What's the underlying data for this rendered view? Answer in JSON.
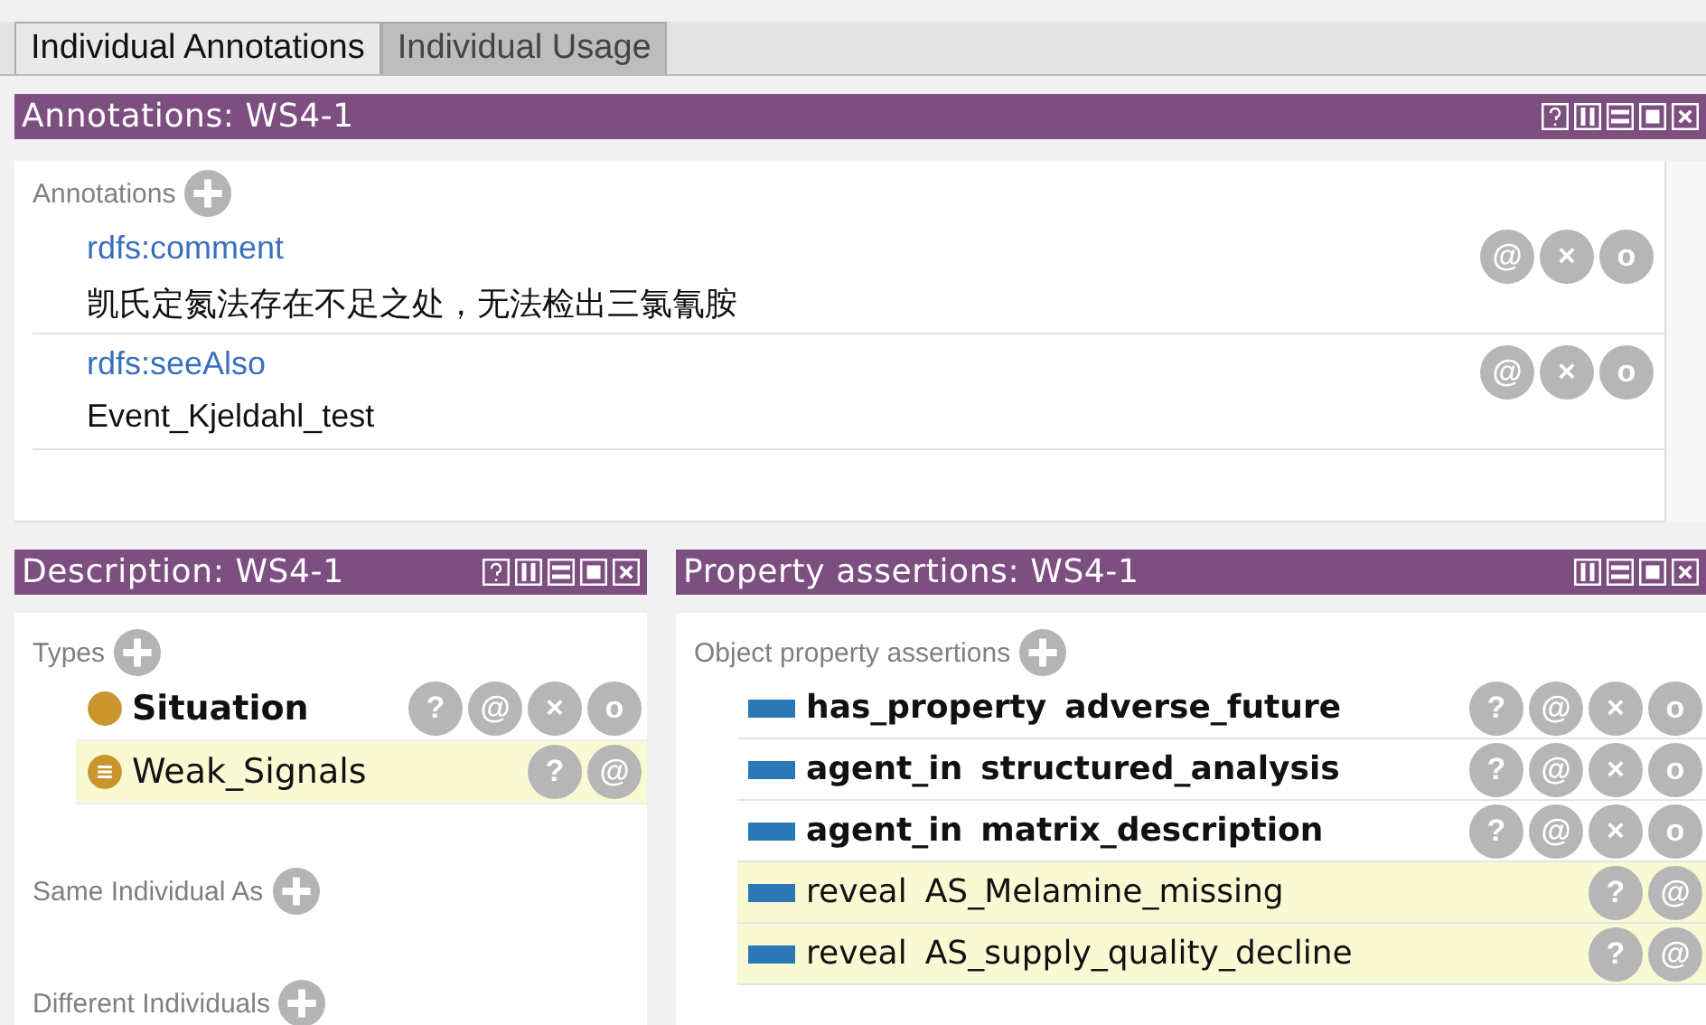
{
  "tabs": [
    {
      "label": "Individual Annotations",
      "selected": true
    },
    {
      "label": "Individual Usage",
      "selected": false
    }
  ],
  "annotations": {
    "title": "Annotations: WS4-1",
    "help": true,
    "section": "Annotations",
    "items": [
      {
        "property": "rdfs:comment",
        "value": "凯氏定氮法存在不足之处，无法检出三氯氰胺",
        "actions": [
          "@",
          "×",
          "o"
        ]
      },
      {
        "property": "rdfs:seeAlso",
        "value": "Event_Kjeldahl_test",
        "actions": [
          "@",
          "×",
          "o"
        ]
      }
    ]
  },
  "description": {
    "title": "Description: WS4-1",
    "help": true,
    "sections": [
      {
        "label": "Types",
        "items": [
          {
            "label": "Situation",
            "inferred": false,
            "actions": [
              "?",
              "@",
              "×",
              "o"
            ]
          },
          {
            "label": "Weak_Signals",
            "inferred": true,
            "actions": [
              "?",
              "@"
            ]
          }
        ]
      },
      {
        "label": "Same Individual As"
      },
      {
        "label": "Different Individuals"
      }
    ]
  },
  "properties": {
    "title": "Property assertions: WS4-1",
    "help": false,
    "section": "Object property assertions",
    "items": [
      {
        "property": "has_property",
        "object": "adverse_future",
        "inferred": false,
        "actions": [
          "?",
          "@",
          "×",
          "o"
        ]
      },
      {
        "property": "agent_in",
        "object": "structured_analysis",
        "inferred": false,
        "actions": [
          "?",
          "@",
          "×",
          "o"
        ]
      },
      {
        "property": "agent_in",
        "object": "matrix_description",
        "inferred": false,
        "actions": [
          "?",
          "@",
          "×",
          "o"
        ]
      },
      {
        "property": "reveal",
        "object": "AS_Melamine_missing",
        "inferred": true,
        "actions": [
          "?",
          "@"
        ]
      },
      {
        "property": "reveal",
        "object": "AS_supply_quality_decline",
        "inferred": true,
        "actions": [
          "?",
          "@"
        ]
      }
    ]
  }
}
